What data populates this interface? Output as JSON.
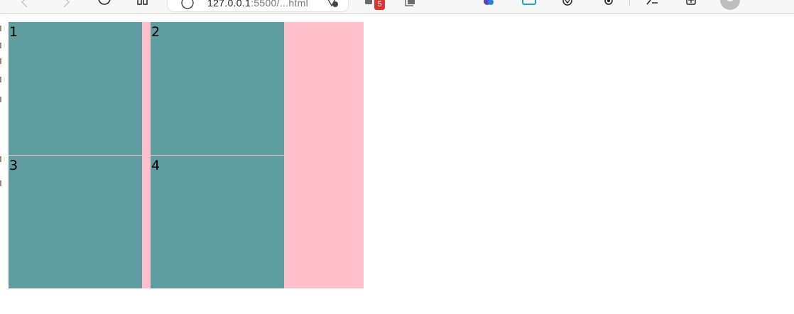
{
  "browser": {
    "url_host": "127.0.0.1",
    "url_path": ":5500/...html",
    "tab_badge_count": "5",
    "icons": [
      "back-icon",
      "forward-icon",
      "refresh-icon",
      "tabs-icon",
      "info-icon",
      "add-favorite-icon",
      "extension-icon",
      "collections-icon",
      "copilot-icon",
      "extension-icon",
      "favorites-icon",
      "settings-icon",
      "feedback-icon",
      "workspaces-icon",
      "profile-avatar"
    ]
  },
  "page": {
    "container_color": "#ffc0cb",
    "box_color": "#5f9ea0",
    "boxes": [
      {
        "label": "1"
      },
      {
        "label": "2"
      },
      {
        "label": "3"
      },
      {
        "label": "4"
      }
    ]
  }
}
